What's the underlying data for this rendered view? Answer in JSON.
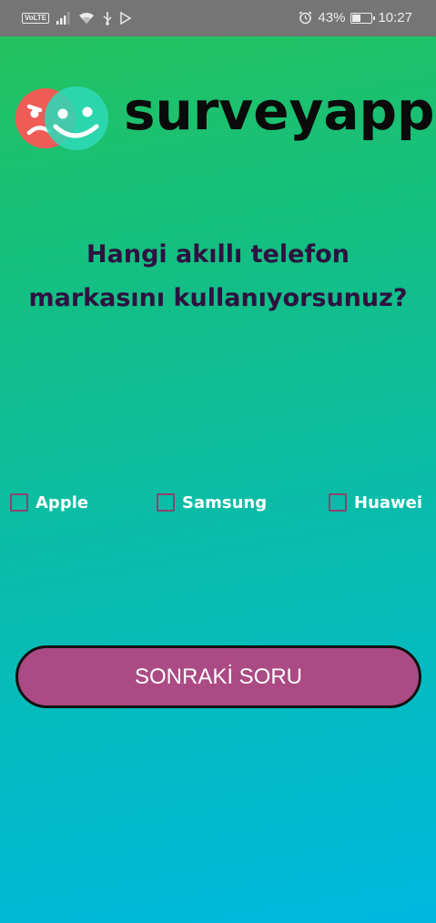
{
  "status_bar": {
    "volte": "VoLTE",
    "battery_percent_text": "43%",
    "battery_level": 0.43,
    "time": "10:27",
    "icons": [
      "volte-icon",
      "signal-icon",
      "wifi-icon",
      "usb-icon",
      "play-store-icon",
      "alarm-icon",
      "battery-icon"
    ]
  },
  "header": {
    "logo_icon": "sad-happy-faces-logo",
    "brand": "surveyapp",
    "colors": {
      "sad_face": "#ef5b55",
      "happy_face": "#2fd8b6"
    }
  },
  "question": {
    "line1": "Hangi akıllı telefon",
    "line2": "markasını kullanıyorsunuz?"
  },
  "options": [
    {
      "label": "Apple",
      "checked": false
    },
    {
      "label": "Samsung",
      "checked": false
    },
    {
      "label": "Huawei",
      "checked": false
    }
  ],
  "next_button": {
    "label": "SONRAKİ SORU",
    "color": "#ab4a84"
  }
}
